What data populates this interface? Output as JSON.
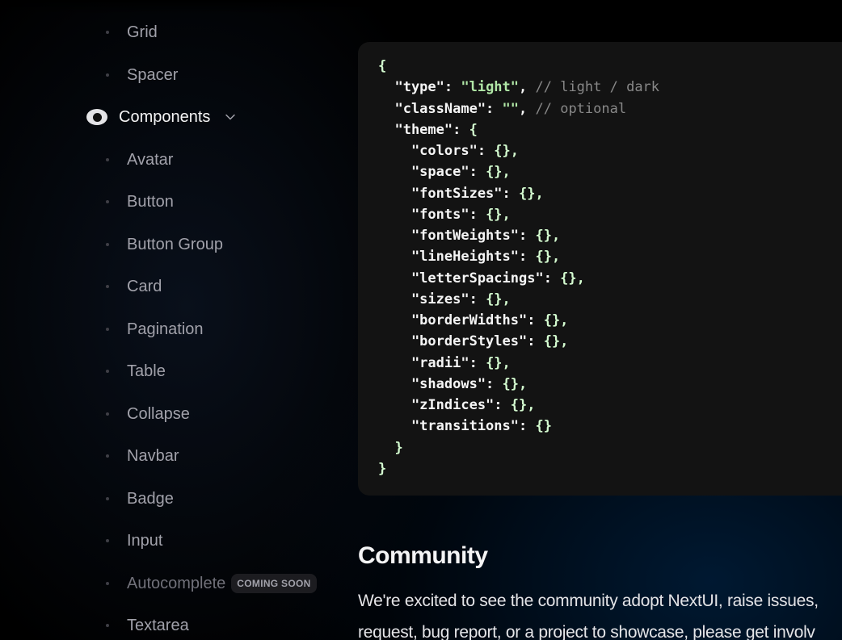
{
  "sidebar": {
    "items_before": [
      {
        "label": "Grid"
      },
      {
        "label": "Spacer"
      }
    ],
    "section": {
      "label": "Components",
      "icon": "components-icon",
      "chevron_icon": "chevron-down-icon"
    },
    "items": [
      {
        "label": "Avatar"
      },
      {
        "label": "Button"
      },
      {
        "label": "Button Group"
      },
      {
        "label": "Card"
      },
      {
        "label": "Pagination"
      },
      {
        "label": "Table"
      },
      {
        "label": "Collapse"
      },
      {
        "label": "Navbar"
      },
      {
        "label": "Badge"
      },
      {
        "label": "Input"
      },
      {
        "label": "Autocomplete",
        "badge": "COMING SOON"
      },
      {
        "label": "Textarea"
      }
    ]
  },
  "code": {
    "lines": [
      [
        {
          "t": "{",
          "c": "pun"
        }
      ],
      [
        {
          "t": "  \"type\": ",
          "c": "key"
        },
        {
          "t": "\"light\"",
          "c": "str"
        },
        {
          "t": ", ",
          "c": "key"
        },
        {
          "t": "// light / dark",
          "c": "comment"
        }
      ],
      [
        {
          "t": "  \"className\": ",
          "c": "key"
        },
        {
          "t": "\"\"",
          "c": "str"
        },
        {
          "t": ", ",
          "c": "key"
        },
        {
          "t": "// optional",
          "c": "comment"
        }
      ],
      [
        {
          "t": "  \"theme\": ",
          "c": "key"
        },
        {
          "t": "{",
          "c": "pun"
        }
      ],
      [
        {
          "t": "    \"colors\": ",
          "c": "key"
        },
        {
          "t": "{},",
          "c": "pun"
        }
      ],
      [
        {
          "t": "    \"space\": ",
          "c": "key"
        },
        {
          "t": "{},",
          "c": "pun"
        }
      ],
      [
        {
          "t": "    \"fontSizes\": ",
          "c": "key"
        },
        {
          "t": "{},",
          "c": "pun"
        }
      ],
      [
        {
          "t": "    \"fonts\": ",
          "c": "key"
        },
        {
          "t": "{},",
          "c": "pun"
        }
      ],
      [
        {
          "t": "    \"fontWeights\": ",
          "c": "key"
        },
        {
          "t": "{},",
          "c": "pun"
        }
      ],
      [
        {
          "t": "    \"lineHeights\": ",
          "c": "key"
        },
        {
          "t": "{},",
          "c": "pun"
        }
      ],
      [
        {
          "t": "    \"letterSpacings\": ",
          "c": "key"
        },
        {
          "t": "{},",
          "c": "pun"
        }
      ],
      [
        {
          "t": "    \"sizes\": ",
          "c": "key"
        },
        {
          "t": "{},",
          "c": "pun"
        }
      ],
      [
        {
          "t": "    \"borderWidths\": ",
          "c": "key"
        },
        {
          "t": "{},",
          "c": "pun"
        }
      ],
      [
        {
          "t": "    \"borderStyles\": ",
          "c": "key"
        },
        {
          "t": "{},",
          "c": "pun"
        }
      ],
      [
        {
          "t": "    \"radii\": ",
          "c": "key"
        },
        {
          "t": "{},",
          "c": "pun"
        }
      ],
      [
        {
          "t": "    \"shadows\": ",
          "c": "key"
        },
        {
          "t": "{},",
          "c": "pun"
        }
      ],
      [
        {
          "t": "    \"zIndices\": ",
          "c": "key"
        },
        {
          "t": "{},",
          "c": "pun"
        }
      ],
      [
        {
          "t": "    \"transitions\": ",
          "c": "key"
        },
        {
          "t": "{}",
          "c": "pun"
        }
      ],
      [
        {
          "t": "  }",
          "c": "pun"
        }
      ],
      [
        {
          "t": "}",
          "c": "pun"
        }
      ]
    ]
  },
  "community": {
    "title": "Community",
    "line1": "We're excited to see the community adopt NextUI, raise issues,",
    "line2": "request, bug report, or a project to showcase, please get involv"
  }
}
